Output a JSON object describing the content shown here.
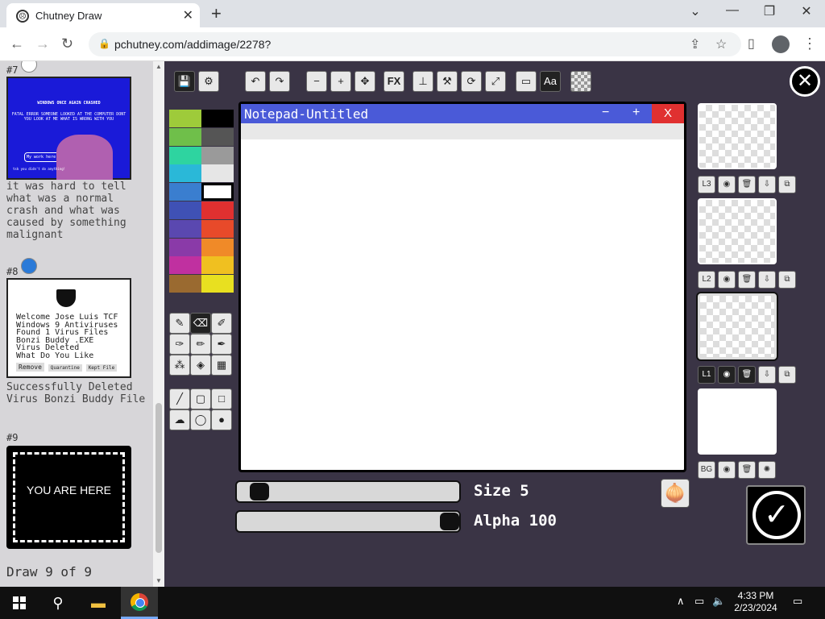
{
  "browser": {
    "tab_title": "Chutney Draw",
    "url": "pchutney.com/addimage/2278?",
    "new_tab": "+",
    "tab_close": "✕",
    "window_controls": {
      "collapse": "⌄",
      "minimize": "—",
      "restore": "❐",
      "close": "✕"
    },
    "nav": {
      "back": "←",
      "forward": "→",
      "reload": "↻"
    }
  },
  "gallery": {
    "items": [
      {
        "number": "#7",
        "thumb_title": "WINDOWS ONCE AGAIN CRASHED",
        "thumb_text": "FATAL ERROR SOMEONE LOOKED AT THE COMPUTER DONT YOU LOOK AT ME WHAT IS WRONG WITH YOU",
        "thumb_bubble": "My work here is done",
        "thumb_footer": "tsk you didn't do anything!",
        "caption": "it was hard to tell what was a normal crash and what was caused by something malignant"
      },
      {
        "number": "#8",
        "thumb_lines": [
          "Welcome Jose Luis TCF",
          "Windows 9 Antiviruses",
          "Found 1 Virus Files",
          "Bonzi Buddy .EXE",
          "Virus Deleted",
          "What Do You Like"
        ],
        "thumb_buttons": [
          "Remove",
          "Quarantine",
          "Kept File"
        ],
        "caption": "Successfully Deleted Virus Bonzi Buddy File"
      },
      {
        "number": "#9",
        "thumb_text": "YOU ARE HERE",
        "caption": ""
      }
    ],
    "draw_count": "Draw 9 of 9"
  },
  "editor": {
    "notepad_title": "Notepad-Untitled",
    "notepad_buttons": {
      "minimize": "−",
      "maximize": "+",
      "close": "X"
    },
    "size_label": "Size 5",
    "alpha_label": "Alpha 100",
    "size_value": 5,
    "alpha_value": 100,
    "fx_label": "FX",
    "text_tool_label": "Aa",
    "palette": [
      "#9ecb3a",
      "#000000",
      "#6fbf4a",
      "#555555",
      "#2ed4a0",
      "#9a9a9a",
      "#2ab8d8",
      "#e6e6e6",
      "#3a7ecf",
      "#ffffff",
      "#3f51b5",
      "#e03030",
      "#5a48b0",
      "#e84a2a",
      "#8a3aa8",
      "#f08a28",
      "#c030a0",
      "#f0c020",
      "#9a6a30",
      "#e8e020"
    ],
    "layers": [
      {
        "label": "L3"
      },
      {
        "label": "L2"
      },
      {
        "label": "L1"
      },
      {
        "label": "BG"
      }
    ],
    "close_label": "✕",
    "confirm_label": "✓"
  },
  "taskbar": {
    "time": "4:33 PM",
    "date": "2/23/2024"
  }
}
